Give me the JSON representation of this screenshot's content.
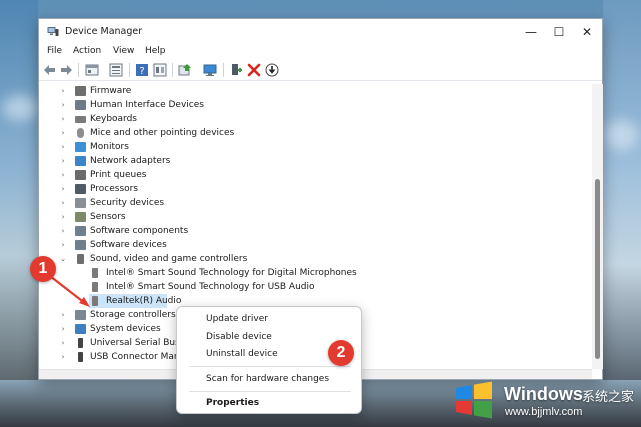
{
  "window": {
    "title": "Device Manager",
    "controls": {
      "minimize": "—",
      "maximize": "☐",
      "close": "✕"
    }
  },
  "menubar": [
    "File",
    "Action",
    "View",
    "Help"
  ],
  "toolbar": {
    "icons": [
      "back-arrow-icon",
      "forward-arrow-icon",
      "properties-icon",
      "view-icon",
      "help-icon",
      "details-icon",
      "update-driver-icon",
      "monitor-scan-icon",
      "add-driver-icon",
      "uninstall-x-icon",
      "disable-download-icon"
    ]
  },
  "tree": {
    "rows": [
      {
        "label": "Firmware",
        "icon_color": "#6e6e6e",
        "expanded": false,
        "level": 0
      },
      {
        "label": "Human Interface Devices",
        "icon_color": "#6f7b87",
        "expanded": false,
        "level": 0
      },
      {
        "label": "Keyboards",
        "icon_color": "#7a7a7a",
        "expanded": false,
        "level": 0
      },
      {
        "label": "Mice and other pointing devices",
        "icon_color": "#8e8e8e",
        "expanded": false,
        "level": 0
      },
      {
        "label": "Monitors",
        "icon_color": "#3d8fd6",
        "expanded": false,
        "level": 0
      },
      {
        "label": "Network adapters",
        "icon_color": "#3a86c8",
        "expanded": false,
        "level": 0
      },
      {
        "label": "Print queues",
        "icon_color": "#6b6b6b",
        "expanded": false,
        "level": 0
      },
      {
        "label": "Processors",
        "icon_color": "#4f5b64",
        "expanded": false,
        "level": 0
      },
      {
        "label": "Security devices",
        "icon_color": "#8a8f96",
        "expanded": false,
        "level": 0
      },
      {
        "label": "Sensors",
        "icon_color": "#7d8a6a",
        "expanded": false,
        "level": 0
      },
      {
        "label": "Software components",
        "icon_color": "#6e7f8e",
        "expanded": false,
        "level": 0
      },
      {
        "label": "Software devices",
        "icon_color": "#6e7f8e",
        "expanded": false,
        "level": 0
      },
      {
        "label": "Sound, video and game controllers",
        "icon_color": "#6f6f6f",
        "expanded": true,
        "level": 0
      },
      {
        "label": "Intel® Smart Sound Technology for Digital Microphones",
        "icon_color": "#7a7a7a",
        "expanded": null,
        "level": 1
      },
      {
        "label": "Intel® Smart Sound Technology for USB Audio",
        "icon_color": "#7a7a7a",
        "expanded": null,
        "level": 1
      },
      {
        "label": "Realtek(R) Audio",
        "icon_color": "#7a7a7a",
        "expanded": null,
        "level": 1,
        "selected": true
      },
      {
        "label": "Storage controllers",
        "icon_color": "#7b8791",
        "expanded": false,
        "level": 0
      },
      {
        "label": "System devices",
        "icon_color": "#3f7fbf",
        "expanded": false,
        "level": 0
      },
      {
        "label": "Universal Serial Bus c",
        "icon_color": "#444444",
        "expanded": false,
        "level": 0
      },
      {
        "label": "USB Connector Mana",
        "icon_color": "#444444",
        "expanded": false,
        "level": 0
      }
    ]
  },
  "context_menu": {
    "items": [
      {
        "label": "Update driver",
        "bold": false
      },
      {
        "label": "Disable device",
        "bold": false
      },
      {
        "label": "Uninstall device",
        "bold": false
      },
      {
        "label": "Scan for hardware changes",
        "bold": false
      },
      {
        "label": "Properties",
        "bold": true
      }
    ]
  },
  "callouts": [
    "1",
    "2"
  ],
  "watermark": {
    "brand": "Windows",
    "chinese": "系统之家",
    "url": "www.bjjmlv.com"
  },
  "colors": {
    "accent_red": "#e23a2e",
    "selection": "#cce4f7"
  }
}
